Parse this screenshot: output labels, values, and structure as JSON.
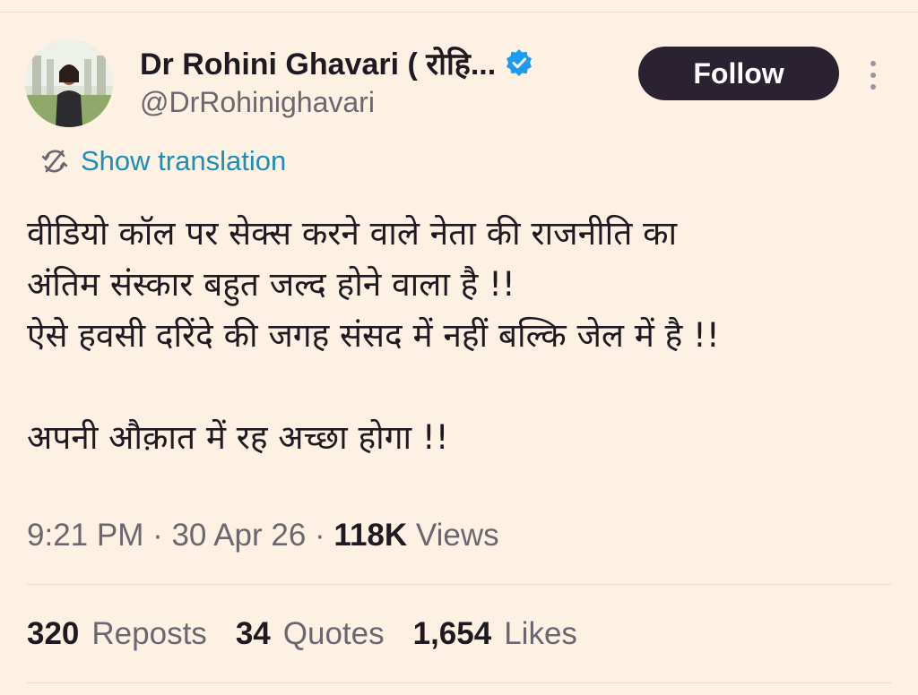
{
  "author": {
    "display_name": "Dr Rohini Ghavari ( रोहि...",
    "handle": "@DrRohinighavari",
    "verified": true,
    "follow_label": "Follow"
  },
  "translation": {
    "label": "Show translation"
  },
  "tweet": {
    "lines": [
      "वीडियो कॉल पर सेक्स करने वाले नेता की राजनीति का",
      "अंतिम संस्कार बहुत जल्द होने वाला है !!",
      "ऐसे हवसी दरिंदे की जगह संसद में नहीं बल्कि जेल में है !!",
      "",
      "अपनी औक़ात में रह अच्छा होगा  !!"
    ]
  },
  "meta": {
    "time": "9:21 PM",
    "separator1": " · ",
    "date": "30 Apr 26",
    "separator2": " · ",
    "views_count": "118K",
    "views_label": " Views"
  },
  "stats": {
    "reposts_count": "320",
    "reposts_label": "Reposts",
    "quotes_count": "34",
    "quotes_label": "Quotes",
    "likes_count": "1,654",
    "likes_label": "Likes"
  },
  "colors": {
    "background": "#fdf1e4",
    "link": "#1d8fb3",
    "verified": "#1d9bf0",
    "follow_button": "#2a2230"
  },
  "icons": {
    "verified": "verified-badge-icon",
    "translate": "translate-icon",
    "more": "more-vertical-icon"
  }
}
